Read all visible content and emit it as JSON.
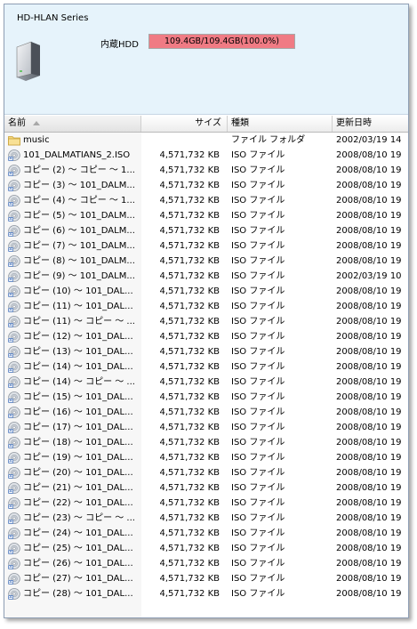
{
  "header": {
    "series_title": "HD-HLAN Series",
    "hdd_label": "内蔵HDD",
    "hdd_usage_text": "109.4GB/109.4GB(100.0%)",
    "hdd_usage_fraction": 1.0,
    "hdd_bar_color": "#f07b84"
  },
  "columns": {
    "name": "名前",
    "size": "サイズ",
    "type": "種類",
    "date": "更新日時"
  },
  "files": [
    {
      "icon": "folder-icon",
      "name": "music",
      "size": "",
      "type": "ファイル フォルダ",
      "date": "2002/03/19 14"
    },
    {
      "icon": "iso-disc-icon",
      "name": "101_DALMATIANS_2.ISO",
      "size": "4,571,732 KB",
      "type": "ISO ファイル",
      "date": "2008/08/10 19"
    },
    {
      "icon": "iso-disc-icon",
      "name": "コピー (2) ～ コピー ～ 1...",
      "size": "4,571,732 KB",
      "type": "ISO ファイル",
      "date": "2008/08/10 19"
    },
    {
      "icon": "iso-disc-icon",
      "name": "コピー (3) ～ 101_DALM...",
      "size": "4,571,732 KB",
      "type": "ISO ファイル",
      "date": "2008/08/10 19"
    },
    {
      "icon": "iso-disc-icon",
      "name": "コピー (4) ～ コピー ～ 1...",
      "size": "4,571,732 KB",
      "type": "ISO ファイル",
      "date": "2008/08/10 19"
    },
    {
      "icon": "iso-disc-icon",
      "name": "コピー (5) ～ 101_DALM...",
      "size": "4,571,732 KB",
      "type": "ISO ファイル",
      "date": "2008/08/10 19"
    },
    {
      "icon": "iso-disc-icon",
      "name": "コピー (6) ～ 101_DALM...",
      "size": "4,571,732 KB",
      "type": "ISO ファイル",
      "date": "2008/08/10 19"
    },
    {
      "icon": "iso-disc-icon",
      "name": "コピー (7) ～ 101_DALM...",
      "size": "4,571,732 KB",
      "type": "ISO ファイル",
      "date": "2008/08/10 19"
    },
    {
      "icon": "iso-disc-icon",
      "name": "コピー (8) ～ 101_DALM...",
      "size": "4,571,732 KB",
      "type": "ISO ファイル",
      "date": "2008/08/10 19"
    },
    {
      "icon": "iso-disc-icon",
      "name": "コピー (9) ～ 101_DALM...",
      "size": "4,571,732 KB",
      "type": "ISO ファイル",
      "date": "2002/03/19 10"
    },
    {
      "icon": "iso-disc-icon",
      "name": "コピー (10) ～ 101_DAL...",
      "size": "4,571,732 KB",
      "type": "ISO ファイル",
      "date": "2008/08/10 19"
    },
    {
      "icon": "iso-disc-icon",
      "name": "コピー (11) ～ 101_DAL...",
      "size": "4,571,732 KB",
      "type": "ISO ファイル",
      "date": "2008/08/10 19"
    },
    {
      "icon": "iso-disc-icon",
      "name": "コピー (11) ～ コピー ～ ...",
      "size": "4,571,732 KB",
      "type": "ISO ファイル",
      "date": "2008/08/10 19"
    },
    {
      "icon": "iso-disc-icon",
      "name": "コピー (12) ～ 101_DAL...",
      "size": "4,571,732 KB",
      "type": "ISO ファイル",
      "date": "2008/08/10 19"
    },
    {
      "icon": "iso-disc-icon",
      "name": "コピー (13) ～ 101_DAL...",
      "size": "4,571,732 KB",
      "type": "ISO ファイル",
      "date": "2008/08/10 19"
    },
    {
      "icon": "iso-disc-icon",
      "name": "コピー (14) ～ 101_DAL...",
      "size": "4,571,732 KB",
      "type": "ISO ファイル",
      "date": "2008/08/10 19"
    },
    {
      "icon": "iso-disc-icon",
      "name": "コピー (14) ～ コピー ～ ...",
      "size": "4,571,732 KB",
      "type": "ISO ファイル",
      "date": "2008/08/10 19"
    },
    {
      "icon": "iso-disc-icon",
      "name": "コピー (15) ～ 101_DAL...",
      "size": "4,571,732 KB",
      "type": "ISO ファイル",
      "date": "2008/08/10 19"
    },
    {
      "icon": "iso-disc-icon",
      "name": "コピー (16) ～ 101_DAL...",
      "size": "4,571,732 KB",
      "type": "ISO ファイル",
      "date": "2008/08/10 19"
    },
    {
      "icon": "iso-disc-icon",
      "name": "コピー (17) ～ 101_DAL...",
      "size": "4,571,732 KB",
      "type": "ISO ファイル",
      "date": "2008/08/10 19"
    },
    {
      "icon": "iso-disc-icon",
      "name": "コピー (18) ～ 101_DAL...",
      "size": "4,571,732 KB",
      "type": "ISO ファイル",
      "date": "2008/08/10 19"
    },
    {
      "icon": "iso-disc-icon",
      "name": "コピー (19) ～ 101_DAL...",
      "size": "4,571,732 KB",
      "type": "ISO ファイル",
      "date": "2008/08/10 19"
    },
    {
      "icon": "iso-disc-icon",
      "name": "コピー (20) ～ 101_DAL...",
      "size": "4,571,732 KB",
      "type": "ISO ファイル",
      "date": "2008/08/10 19"
    },
    {
      "icon": "iso-disc-icon",
      "name": "コピー (21) ～ 101_DAL...",
      "size": "4,571,732 KB",
      "type": "ISO ファイル",
      "date": "2008/08/10 19"
    },
    {
      "icon": "iso-disc-icon",
      "name": "コピー (22) ～ 101_DAL...",
      "size": "4,571,732 KB",
      "type": "ISO ファイル",
      "date": "2008/08/10 19"
    },
    {
      "icon": "iso-disc-icon",
      "name": "コピー (23) ～ コピー ～ ...",
      "size": "4,571,732 KB",
      "type": "ISO ファイル",
      "date": "2008/08/10 19"
    },
    {
      "icon": "iso-disc-icon",
      "name": "コピー (24) ～ 101_DAL...",
      "size": "4,571,732 KB",
      "type": "ISO ファイル",
      "date": "2008/08/10 19"
    },
    {
      "icon": "iso-disc-icon",
      "name": "コピー (25) ～ 101_DAL...",
      "size": "4,571,732 KB",
      "type": "ISO ファイル",
      "date": "2008/08/10 19"
    },
    {
      "icon": "iso-disc-icon",
      "name": "コピー (26) ～ 101_DAL...",
      "size": "4,571,732 KB",
      "type": "ISO ファイル",
      "date": "2008/08/10 19"
    },
    {
      "icon": "iso-disc-icon",
      "name": "コピー (27) ～ 101_DAL...",
      "size": "4,571,732 KB",
      "type": "ISO ファイル",
      "date": "2008/08/10 19"
    },
    {
      "icon": "iso-disc-icon",
      "name": "コピー (28) ～ 101_DAL...",
      "size": "4,571,732 KB",
      "type": "ISO ファイル",
      "date": "2008/08/10 19"
    }
  ]
}
